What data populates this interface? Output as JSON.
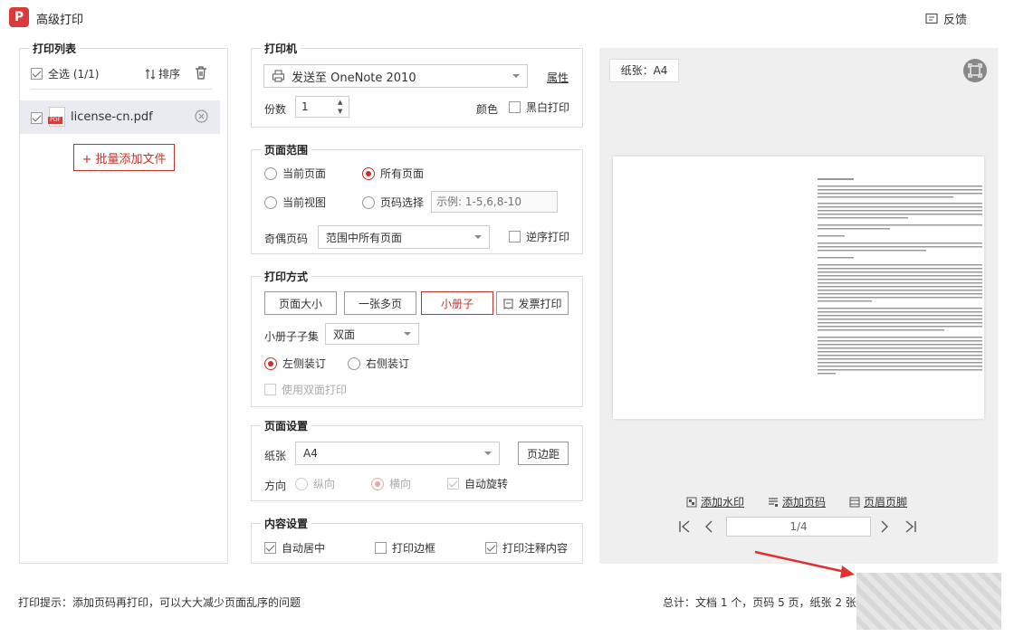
{
  "window": {
    "title": "高级打印",
    "feedback": "反馈"
  },
  "print_list": {
    "legend": "打印列表",
    "select_all": "全选 (1/1)",
    "sort": "排序",
    "file_name": "license-cn.pdf",
    "file_badge": "PDF",
    "batch_add": "+ 批量添加文件"
  },
  "printer": {
    "legend": "打印机",
    "selected": "发送至 OneNote 2010",
    "properties": "属性",
    "copies_label": "份数",
    "copies_value": "1",
    "color_label": "颜色",
    "bw_label": "黑白打印"
  },
  "page_range": {
    "legend": "页面范围",
    "current_page": "当前页面",
    "all_pages": "所有页面",
    "current_view": "当前视图",
    "page_select": "页码选择",
    "page_select_placeholder": "示例: 1-5,6,8-10",
    "odd_even_label": "奇偶页码",
    "odd_even_value": "范围中所有页面",
    "reverse": "逆序打印"
  },
  "print_mode": {
    "legend": "打印方式",
    "page_size": "页面大小",
    "multi_page": "一张多页",
    "booklet": "小册子",
    "invoice": "发票打印",
    "subset_label": "小册子子集",
    "subset_value": "双面",
    "left_bind": "左侧装订",
    "right_bind": "右侧装订",
    "duplex": "使用双面打印"
  },
  "page_setup": {
    "legend": "页面设置",
    "paper_label": "纸张",
    "paper_value": "A4",
    "margins": "页边距",
    "orientation_label": "方向",
    "portrait": "纵向",
    "landscape": "横向",
    "auto_rotate": "自动旋转"
  },
  "content_setup": {
    "legend": "内容设置",
    "auto_center": "自动居中",
    "print_border": "打印边框",
    "print_annotations": "打印注释内容"
  },
  "preview": {
    "paper_badge": "纸张：A4",
    "add_watermark": "添加水印",
    "add_page_number": "添加页码",
    "header_footer": "页眉页脚",
    "page_indicator": "1/4"
  },
  "footer": {
    "tip": "打印提示：添加页码再打印，可以大大减少页面乱序的问题",
    "summary": "总计：文档 1 个，页码 5 页，纸张 2 张"
  },
  "colors": {
    "accent": "#c9302c",
    "arrow": "#e03030"
  }
}
